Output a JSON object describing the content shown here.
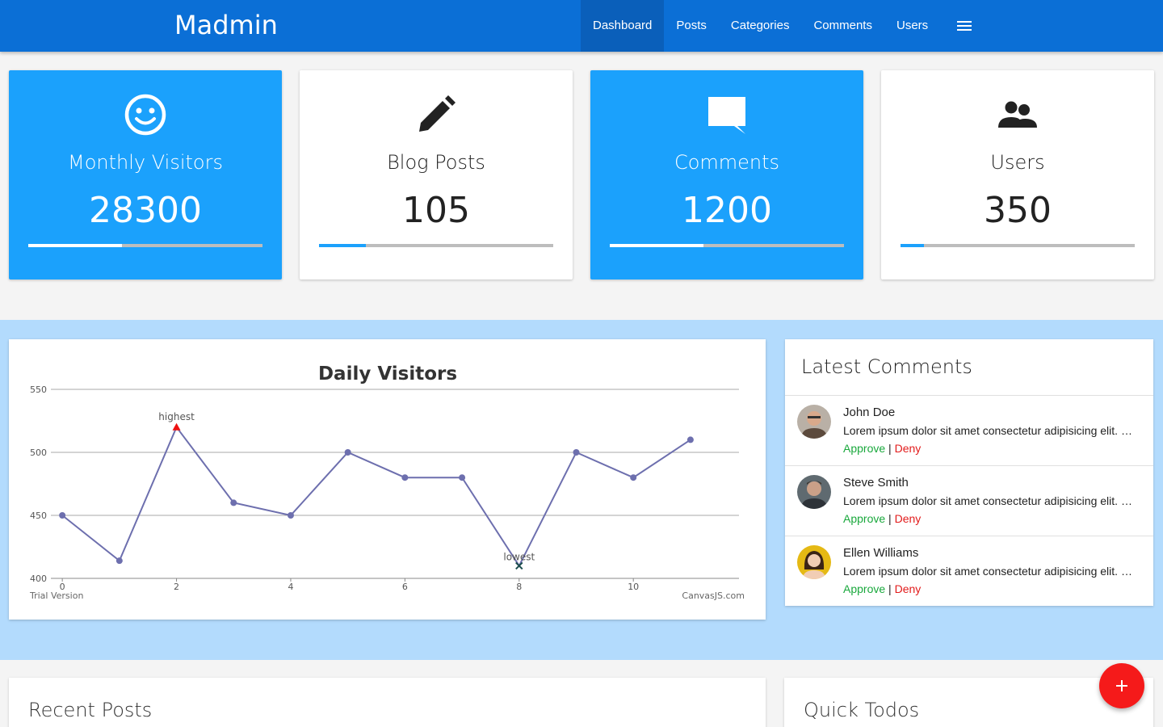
{
  "app": {
    "brand": "Madmin"
  },
  "nav": {
    "items": [
      {
        "label": "Dashboard",
        "active": true
      },
      {
        "label": "Posts"
      },
      {
        "label": "Categories"
      },
      {
        "label": "Comments"
      },
      {
        "label": "Users"
      }
    ],
    "menu_icon": "hamburger-menu-icon"
  },
  "stats": [
    {
      "icon": "smiley-icon",
      "title": "Monthly Visitors",
      "value": "28300",
      "progress": 0.4,
      "style": "blue"
    },
    {
      "icon": "pencil-icon",
      "title": "Blog Posts",
      "value": "105",
      "progress": 0.2,
      "style": "white"
    },
    {
      "icon": "chat-bubble-icon",
      "title": "Comments",
      "value": "1200",
      "progress": 0.4,
      "style": "blue"
    },
    {
      "icon": "users-icon",
      "title": "Users",
      "value": "350",
      "progress": 0.1,
      "style": "white"
    }
  ],
  "chart_data": {
    "type": "line",
    "title": "Daily Visitors",
    "x": [
      0,
      1,
      2,
      3,
      4,
      5,
      6,
      7,
      8,
      9,
      10,
      11
    ],
    "series": [
      {
        "values": [
          450,
          414,
          520,
          460,
          450,
          500,
          480,
          480,
          410,
          500,
          480,
          510
        ]
      }
    ],
    "ylim": [
      400,
      550
    ],
    "yticks": [
      400,
      450,
      500,
      550
    ],
    "xticks": [
      0,
      2,
      4,
      6,
      8,
      10
    ],
    "grid": true,
    "annotations": [
      {
        "x": 2,
        "label": "highest",
        "marker": "triangle",
        "color": "#e11"
      },
      {
        "x": 8,
        "label": "lowest",
        "marker": "cross",
        "color": "#1b4d4d"
      }
    ],
    "series_color": "#6d6fae",
    "footer_left": "Trial Version",
    "footer_right": "CanvasJS.com"
  },
  "comments": {
    "title": "Latest Comments",
    "items": [
      {
        "name": "John Doe",
        "text": "Lorem ipsum dolor sit amet consectetur adipisicing elit. Quas, iure.",
        "approve": "Approve",
        "sep": "|",
        "deny": "Deny",
        "avatar_color": "#8a7a6a"
      },
      {
        "name": "Steve Smith",
        "text": "Lorem ipsum dolor sit amet consectetur adipisicing elit. Quas, iure.",
        "approve": "Approve",
        "sep": "|",
        "deny": "Deny",
        "avatar_color": "#4e4e4e"
      },
      {
        "name": "Ellen Williams",
        "text": "Lorem ipsum dolor sit amet consectetur adipisicing elit. Quas, iure.",
        "approve": "Approve",
        "sep": "|",
        "deny": "Deny",
        "avatar_color": "#e5b914"
      }
    ]
  },
  "recent_posts": {
    "title": "Recent Posts"
  },
  "quick_todos": {
    "title": "Quick Todos"
  },
  "fab": {
    "icon": "plus-icon"
  },
  "colors": {
    "primary": "#0b6fd6",
    "accent": "#1ba1fc",
    "band": "#b3dbfd",
    "fab": "#f51a1a"
  }
}
